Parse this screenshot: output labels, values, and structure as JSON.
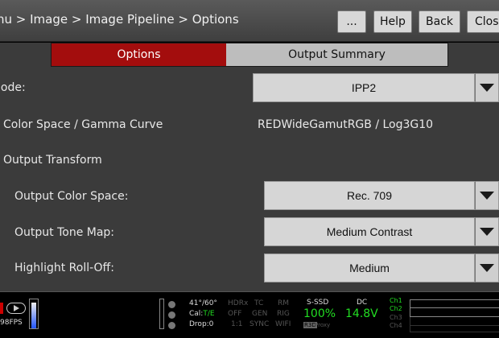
{
  "header": {
    "breadcrumb": "nu > Image > Image Pipeline > Options",
    "buttons": {
      "more": "...",
      "help": "Help",
      "back": "Back",
      "close": "Clos"
    }
  },
  "tabs": {
    "options": "Options",
    "output_summary": "Output Summary"
  },
  "settings": {
    "mode_label": "lode:",
    "mode_value": "IPP2",
    "color_space_label": "Color Space / Gamma Curve",
    "color_space_value": "REDWideGamutRGB / Log3G10",
    "output_transform_label": "Output Transform",
    "output_color_space_label": "Output Color Space:",
    "output_color_space_value": "Rec. 709",
    "output_tone_map_label": "Output Tone Map:",
    "output_tone_map_value": "Medium Contrast",
    "highlight_rolloff_label": "Highlight Roll-Off:",
    "highlight_rolloff_value": "Medium"
  },
  "status": {
    "fps": "98FPS",
    "col1": [
      "41°/60°",
      "Cal:",
      "T/E",
      "Drop:0"
    ],
    "col2": [
      "HDRx",
      "OFF",
      "1:1"
    ],
    "col3": [
      "TC",
      "GEN",
      "SYNC"
    ],
    "col4": [
      "RM",
      "RIG",
      "WIFI"
    ],
    "media_label": "S-SSD",
    "media_value": "100%",
    "media_sub": "R3D",
    "media_sub2": "Proxy",
    "power_label": "DC",
    "power_value": "14.8V",
    "channels": [
      "Ch1",
      "Ch2",
      "Ch3",
      "Ch4"
    ],
    "colors": {
      "accent_red": "#a30d0d",
      "status_green": "#22dd22"
    }
  }
}
